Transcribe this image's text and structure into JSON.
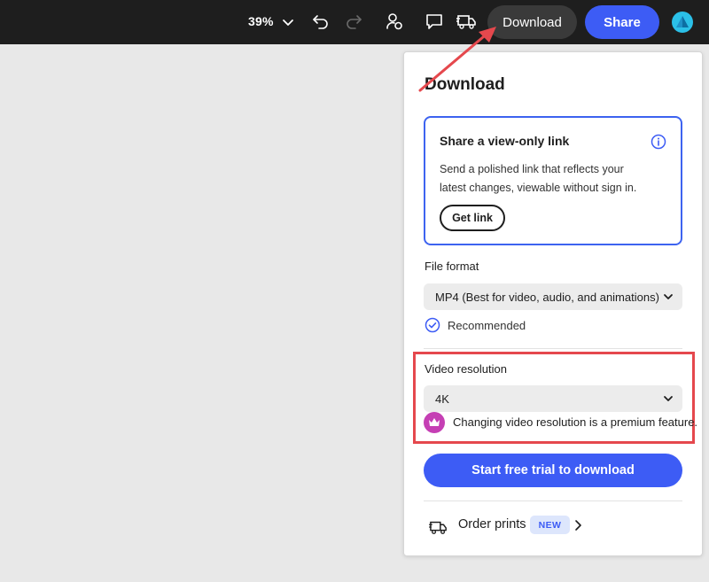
{
  "toolbar": {
    "zoom": "39%",
    "download_label": "Download",
    "share_label": "Share"
  },
  "icons": {
    "zoom_chevron": "chevron-down-icon",
    "undo": "undo-icon",
    "redo": "redo-icon",
    "collaborate": "collaborate-icon",
    "comment": "comment-icon",
    "print": "truck-icon",
    "avatar": "avatar"
  },
  "panel": {
    "title": "Download",
    "share_card": {
      "title": "Share a view-only link",
      "description": "Send a polished link that reflects your latest changes, viewable without sign in.",
      "button": "Get link"
    },
    "file_format": {
      "label": "File format",
      "selected": "MP4 (Best for video, audio, and animations)",
      "recommended": "Recommended"
    },
    "video_resolution": {
      "label": "Video resolution",
      "selected": "4K",
      "premium_note": "Changing video resolution is a premium feature."
    },
    "trial_button": "Start free trial to download",
    "order_prints": {
      "label": "Order prints",
      "badge": "NEW"
    }
  },
  "colors": {
    "accent": "#3d5cf5",
    "topbar": "#1e1e1e",
    "highlight": "#e5484d",
    "premium": "#c53fb4",
    "canvas": "#e8e8e8"
  }
}
